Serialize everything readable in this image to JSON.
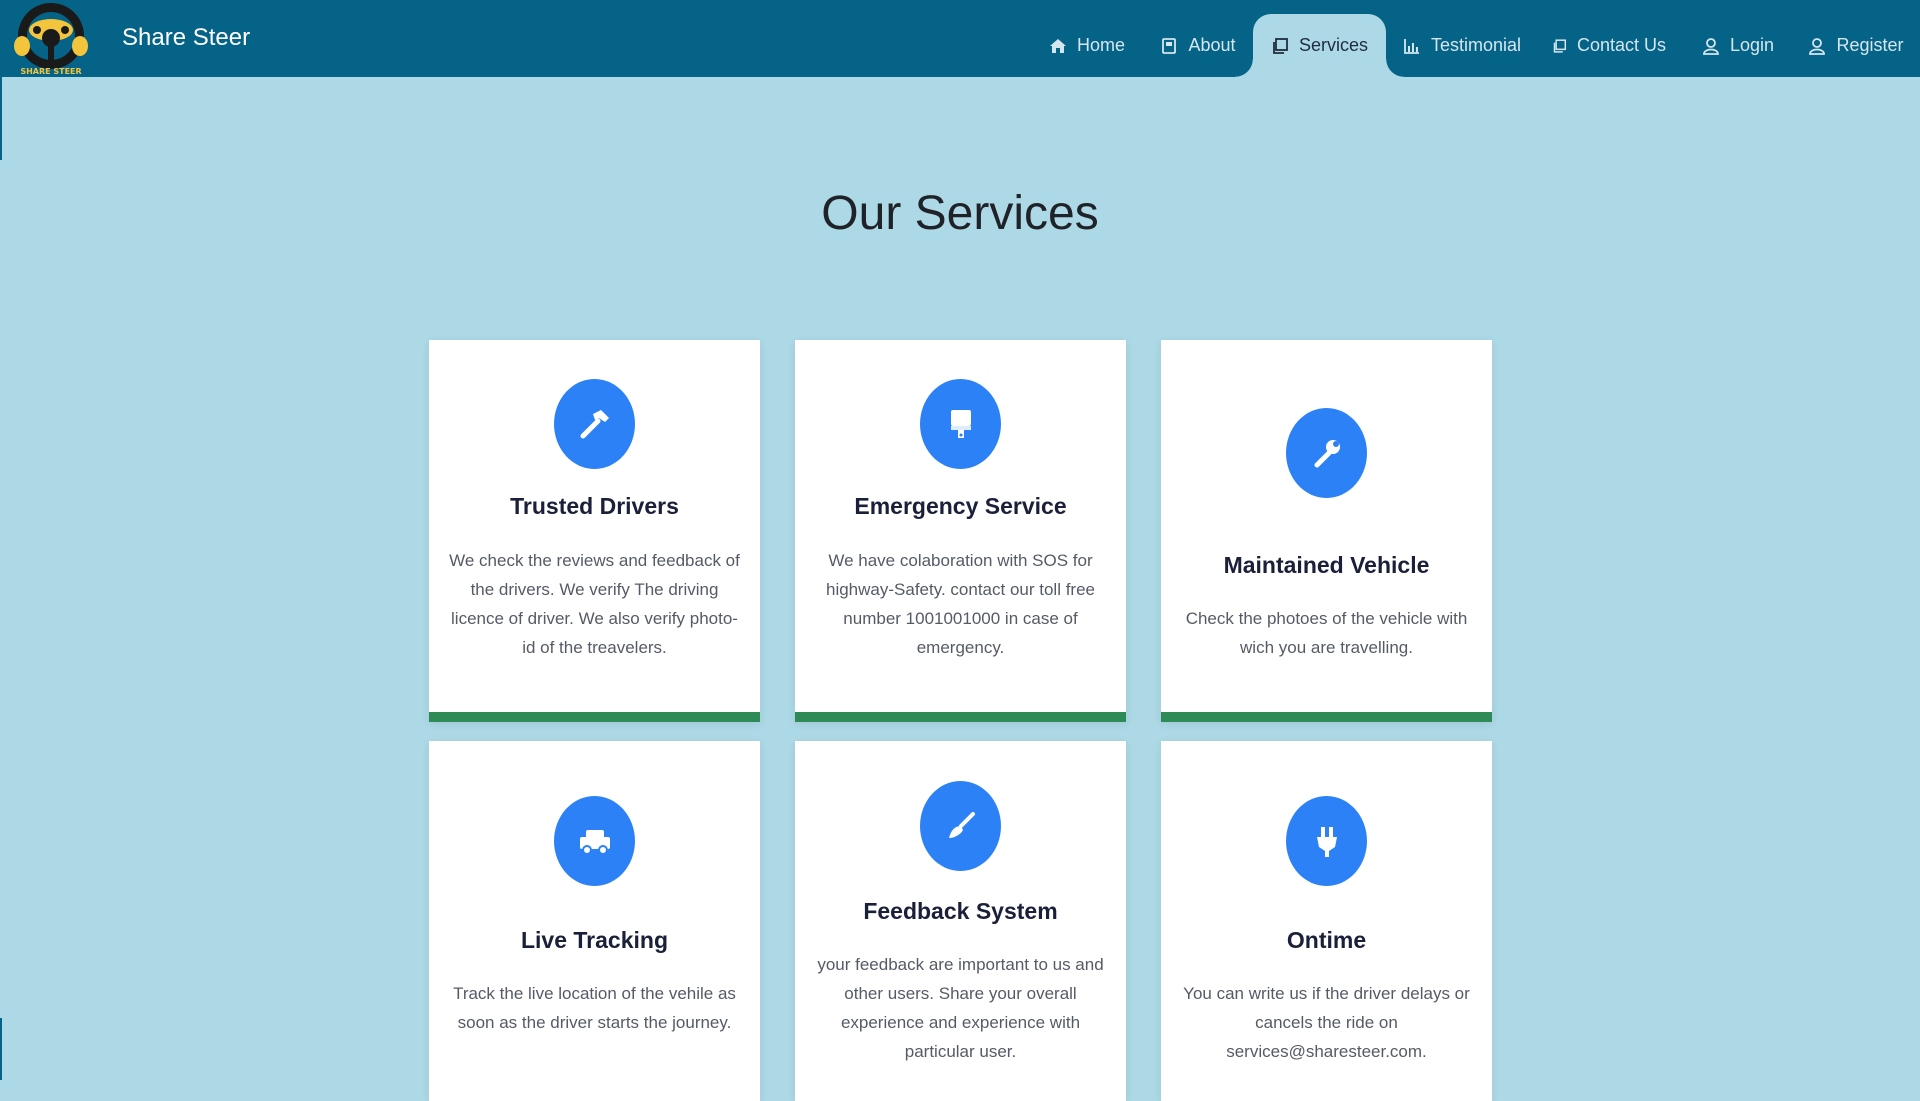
{
  "brand": {
    "name": "Share Steer",
    "logo_text": "SHARE STEER"
  },
  "nav": [
    {
      "label": "Home",
      "icon": "home-icon"
    },
    {
      "label": "About",
      "icon": "book-icon"
    },
    {
      "label": "Services",
      "icon": "copy-icon",
      "active": true
    },
    {
      "label": "Testimonial",
      "icon": "chart-icon"
    },
    {
      "label": "Contact Us",
      "icon": "copy-icon"
    },
    {
      "label": "Login",
      "icon": "user-icon"
    },
    {
      "label": "Register",
      "icon": "user-icon"
    }
  ],
  "page": {
    "title": "Our Services"
  },
  "services": [
    {
      "title": "Trusted Drivers",
      "icon": "hammer-icon",
      "text": "We check the reviews and feedback of the drivers. We verify The driving licence of driver. We also verify photo-id of the treavelers."
    },
    {
      "title": "Emergency Service",
      "icon": "paint-brush-icon",
      "text": "We have colaboration with SOS for highway-Safety. contact our toll free number 1001001000 in case of emergency."
    },
    {
      "title": "Maintained Vehicle",
      "icon": "wrench-icon",
      "text": "Check the photoes of the vehicle with wich you are travelling."
    },
    {
      "title": "Live Tracking",
      "icon": "truck-icon",
      "text": "Track the live location of the vehile as soon as the driver starts the journey."
    },
    {
      "title": "Feedback System",
      "icon": "broom-icon",
      "text": "your feedback are important to us and other users. Share your overall experience and experience with particular user."
    },
    {
      "title": "Ontime",
      "icon": "plug-icon",
      "text": "You can write us if the driver delays or cancels the ride on services@sharesteer.com."
    }
  ],
  "colors": {
    "navbar": "#046386",
    "background": "#add8e6",
    "accent": "#2d81f7",
    "card_border": "#2e8b57"
  }
}
